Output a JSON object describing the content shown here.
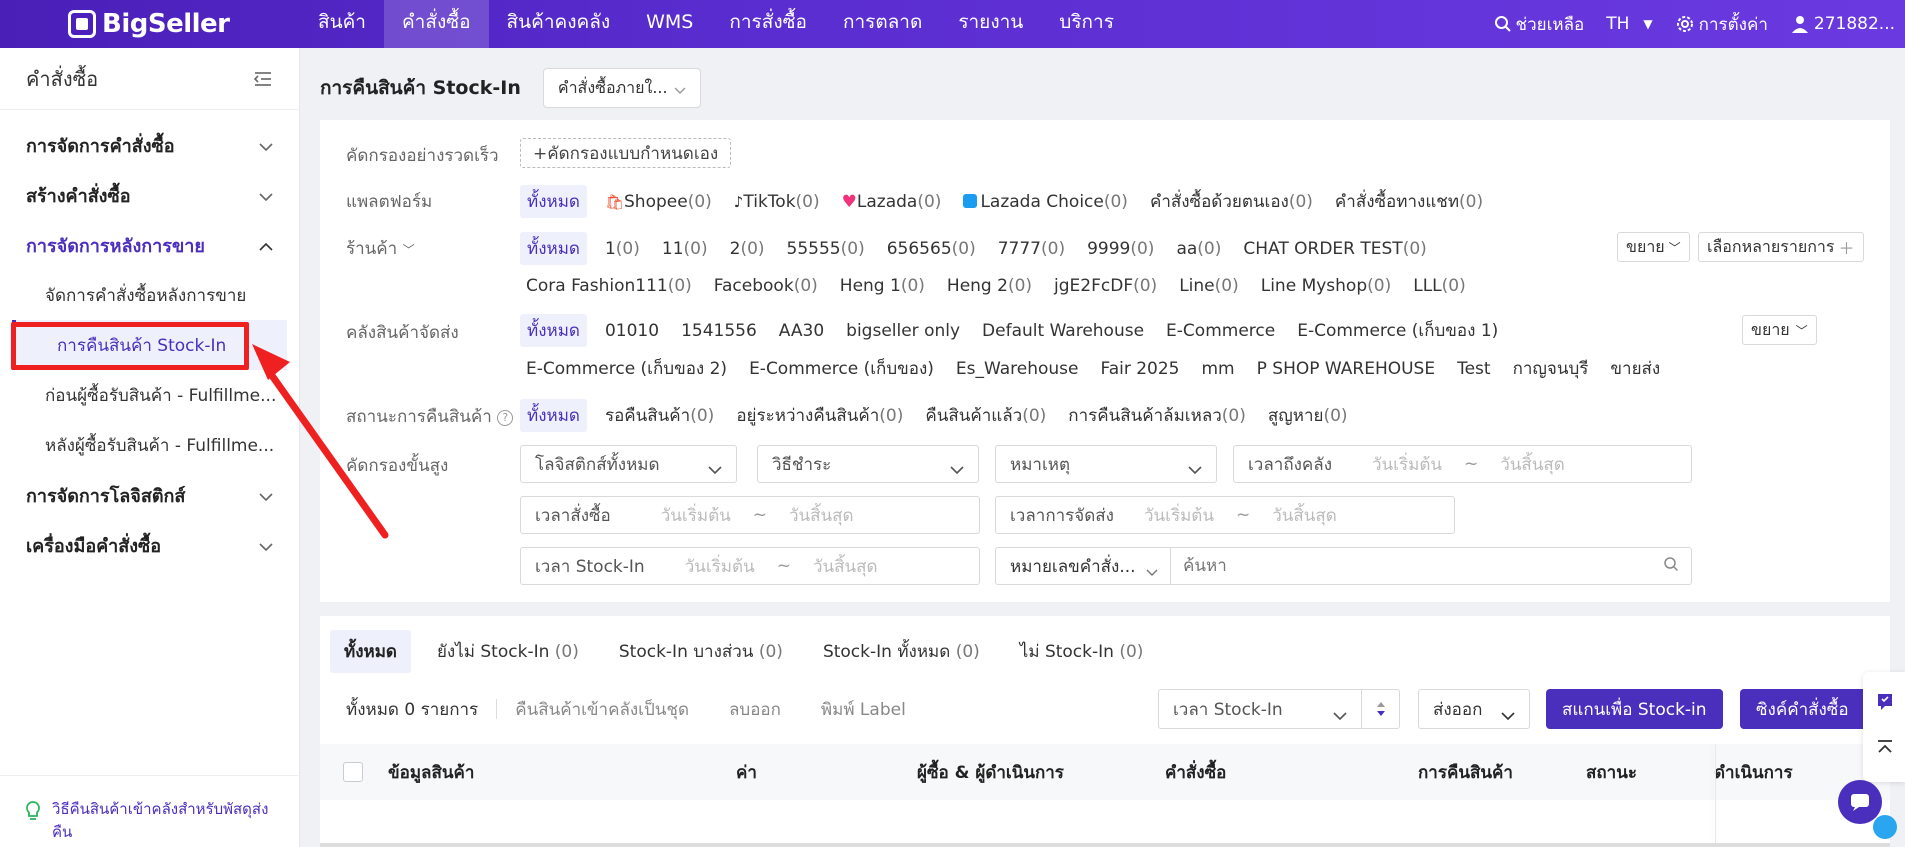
{
  "brand": "BigSeller",
  "nav": [
    "สินค้า",
    "คำสั่งซื้อ",
    "สินค้าคงคลัง",
    "WMS",
    "การสั่งซื้อ",
    "การตลาด",
    "รายงาน",
    "บริการ"
  ],
  "top_right": {
    "help": "ช่วยเหลือ",
    "lang": "TH",
    "settings": "การตั้งค่า",
    "user": "271882..."
  },
  "sidebar": {
    "title": "คำสั่งซื้อ",
    "groups": [
      {
        "label": "การจัดการคำสั่งซื้อ"
      },
      {
        "label": "สร้างคำสั่งซื้อ"
      },
      {
        "label": "การจัดการหลังการขาย"
      }
    ],
    "subs": [
      "จัดการคำสั่งซื้อหลังการขาย",
      "การคืนสินค้า Stock-In",
      "ก่อนผู้ซื้อรับสินค้า - Fulfillme...",
      "หลังผู้ซื้อรับสินค้า - Fulfillme..."
    ],
    "groups2": [
      {
        "label": "การจัดการโลจิสติกส์"
      },
      {
        "label": "เครื่องมือคำสั่งซื้อ"
      }
    ],
    "footer": "วิธีคืนสินค้าเข้าคลังสำหรับพัสดุส่งคืน",
    "footer_line2": "ส่งคืน"
  },
  "header": {
    "title": "การคืนสินค้า Stock-In",
    "dropdown": "คำสั่งซื้อภายใ..."
  },
  "filters": {
    "quick_label": "คัดกรองอย่างรวดเร็ว",
    "custom_btn": "+คัดกรองแบบกำหนดเอง",
    "platform_label": "แพลตฟอร์ม",
    "platforms": [
      {
        "name": "ทั้งหมด",
        "count": ""
      },
      {
        "name": "Shopee",
        "count": "(0)"
      },
      {
        "name": "TikTok",
        "count": "(0)"
      },
      {
        "name": "Lazada",
        "count": "(0)"
      },
      {
        "name": "Lazada Choice",
        "count": "(0)"
      },
      {
        "name": "คำสั่งซื้อด้วยตนเอง",
        "count": "(0)"
      },
      {
        "name": "คำสั่งซื้อทางแชท",
        "count": "(0)"
      }
    ],
    "store_label": "ร้านค้า",
    "stores_row1": [
      {
        "name": "ทั้งหมด",
        "count": ""
      },
      {
        "name": "1",
        "count": "(0)"
      },
      {
        "name": "11",
        "count": "(0)"
      },
      {
        "name": "2",
        "count": "(0)"
      },
      {
        "name": "55555",
        "count": "(0)"
      },
      {
        "name": "656565",
        "count": "(0)"
      },
      {
        "name": "7777",
        "count": "(0)"
      },
      {
        "name": "9999",
        "count": "(0)"
      },
      {
        "name": "aa",
        "count": "(0)"
      },
      {
        "name": "CHAT ORDER TEST",
        "count": "(0)"
      }
    ],
    "stores_row2": [
      {
        "name": "Cora Fashion111",
        "count": "(0)"
      },
      {
        "name": "Facebook",
        "count": "(0)"
      },
      {
        "name": "Heng 1",
        "count": "(0)"
      },
      {
        "name": "Heng 2",
        "count": "(0)"
      },
      {
        "name": "jgE2FcDF",
        "count": "(0)"
      },
      {
        "name": "Line",
        "count": "(0)"
      },
      {
        "name": "Line Myshop",
        "count": "(0)"
      },
      {
        "name": "LLL",
        "count": "(0)"
      }
    ],
    "expand": "ขยาย",
    "multi_select": "เลือกหลายรายการ",
    "warehouse_label": "คลังสินค้าจัดส่ง",
    "warehouses_row1": [
      "ทั้งหมด",
      "01010",
      "1541556",
      "AA30",
      "bigseller only",
      "Default Warehouse",
      "E-Commerce",
      "E-Commerce (เก็บของ 1)"
    ],
    "warehouses_row2": [
      "E-Commerce (เก็บของ 2)",
      "E-Commerce (เก็บของ)",
      "Es_Warehouse",
      "Fair 2025",
      "mm",
      "P SHOP WAREHOUSE",
      "Test",
      "กาญจนบุรี",
      "ขายส่ง"
    ],
    "status_label": "สถานะการคืนสินค้า",
    "statuses": [
      {
        "name": "ทั้งหมด",
        "count": ""
      },
      {
        "name": "รอคืนสินค้า",
        "count": "(0)"
      },
      {
        "name": "อยู่ระหว่างคืนสินค้า",
        "count": "(0)"
      },
      {
        "name": "คืนสินค้าแล้ว",
        "count": "(0)"
      },
      {
        "name": "การคืนสินค้าล้มเหลว",
        "count": "(0)"
      },
      {
        "name": "สูญหาย",
        "count": "(0)"
      }
    ],
    "advanced_label": "คัดกรองขั้นสูง",
    "logistics": "โลจิสติกส์ทั้งหมด",
    "payment": "วิธีชำระ",
    "reason": "หมาเหตุ",
    "arrive_time": "เวลาถึงคลัง",
    "order_time": "เวลาสั่งซื้อ",
    "ship_time": "เวลาการจัดส่ง",
    "stockin_time": "เวลา Stock-In",
    "start": "วันเริ่มต้น",
    "end": "วันสิ้นสุด",
    "tilde": "~",
    "order_no": "หมายเลขคำสั่ง...",
    "search_ph": "ค้นหา"
  },
  "tabs": [
    {
      "label": "ทั้งหมด",
      "count": ""
    },
    {
      "label": "ยังไม่ Stock-In",
      "count": "(0)"
    },
    {
      "label": "Stock-In บางส่วน",
      "count": "(0)"
    },
    {
      "label": "Stock-In ทั้งหมด",
      "count": "(0)"
    },
    {
      "label": "ไม่ Stock-In",
      "count": "(0)"
    }
  ],
  "toolbar": {
    "total": "ทั้งหมด 0 รายการ",
    "batch_return": "คืนสินค้าเข้าคลังเป็นชุด",
    "delete": "ลบออก",
    "print": "พิมพ์ Label",
    "sort": "เวลา Stock-In",
    "export": "ส่งออก",
    "scan": "สแกนเพื่อ Stock-in",
    "sync": "ซิงค์คำสั่งซื้อ"
  },
  "table_headers": [
    "ข้อมูลสินค้า",
    "ค่า",
    "ผู้ซื้อ & ผู้ดำเนินการ",
    "คำสั่งซื้อ",
    "การคืนสินค้า",
    "สถานะ",
    "ดำเนินการ"
  ],
  "colors": {
    "brand": "#4a2fbd",
    "annotation": "#ee2020"
  }
}
